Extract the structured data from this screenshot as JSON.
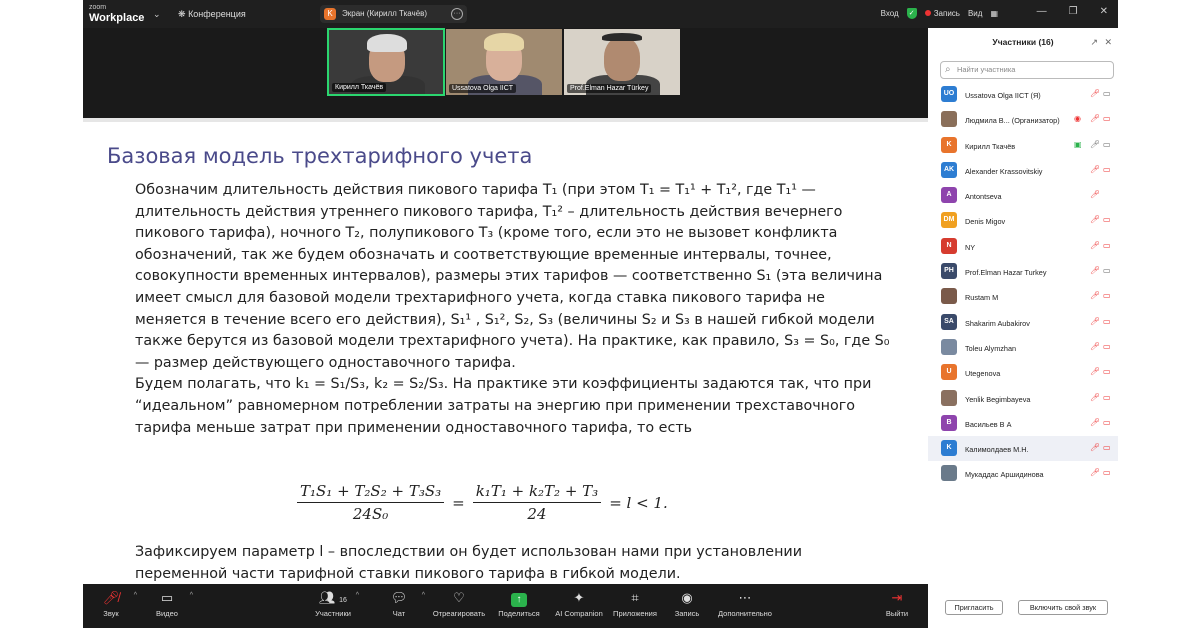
{
  "titlebar": {
    "brand_small": "zoom",
    "brand": "Workplace",
    "conference": "Конференция",
    "share_initial": "K",
    "share_title": "Экран (Кирилл Ткачёв)",
    "view_in": "Вход",
    "record": "Запись",
    "view": "Вид",
    "colors": {
      "bg": "#1f1f1f",
      "record": "#e33333",
      "secure": "#2bb24c"
    }
  },
  "videos": [
    {
      "name": "Кирилл Ткачёв",
      "active": true
    },
    {
      "name": "Ussatova Olga IICT"
    },
    {
      "name": "Prof.Elman Hazar Türkey"
    }
  ],
  "slide": {
    "title": "Базовая модель трехтарифного учета",
    "p1": "Обозначим длительность действия пикового тарифа T₁ (при этом T₁ = T₁¹ + T₁², где T₁¹ — длительность действия утреннего пикового тарифа, T₁² – длительность действия вечернего пикового тарифа), ночного T₂, полупикового T₃ (кроме того, если это не вызовет конфликта обозначений, так же будем обозначать и соответствующие временные интервалы, точнее, совокупности временных интервалов), размеры этих тарифов — соответственно S₁ (эта величина имеет смысл для базовой модели трехтарифного учета, когда ставка пикового тарифа не меняется в течение всего его действия), S₁¹ , S₁², S₂, S₃ (величины S₂ и S₃ в нашей гибкой модели также берутся из базовой модели трехтарифного учета). На практике, как правило, S₃ = S₀, где S₀ — размер действующего одноставочного тарифа.",
    "p2": "Будем полагать, что k₁ = S₁/S₃, k₂ = S₂/S₃. На практике эти коэффициенты задаются так, что при “идеальном” равномерном потреблении затраты на энергию при применении трехставочного тарифа меньше затрат при применении одноставочного тарифа, то есть",
    "f_num1": "T₁S₁ + T₂S₂ + T₃S₃",
    "f_den1": "24S₀",
    "f_eq1": "=",
    "f_num2": "k₁T₁ + k₂T₂ + T₃",
    "f_den2": "24",
    "f_tail": "= l < 1.",
    "p3": "Зафиксируем параметр l – впоследствии он будет использован нами при установлении переменной части тарифной ставки пикового тарифа в гибкой модели."
  },
  "toolbar": {
    "audio": "Звук",
    "video": "Видео",
    "participants": "Участники",
    "participants_count": "16",
    "chat": "Чат",
    "react": "Отреагировать",
    "share": "Поделиться",
    "ai": "AI Companion",
    "apps": "Приложения",
    "record": "Запись",
    "more": "Дополнительно",
    "leave": "Выйти"
  },
  "panel": {
    "title": "Участники (16)",
    "search_placeholder": "Найти участника",
    "invite": "Пригласить",
    "unmute": "Включить свой звук",
    "participants": [
      {
        "initials": "UO",
        "color": "#2d7dd2",
        "name": "Ussatova Olga IICT (Я)",
        "mic": "off",
        "cam": "on"
      },
      {
        "initials": "",
        "color": "#8a6f5a",
        "name": "Людмила В...  (Организатор)",
        "mic": "off",
        "cam": "off",
        "rec": true
      },
      {
        "initials": "K",
        "color": "#e8742c",
        "name": "Кирилл Ткачёв",
        "mic": "on",
        "cam": "on",
        "share": true
      },
      {
        "initials": "AK",
        "color": "#2d7dd2",
        "name": "Alexander Krassovitskiy",
        "mic": "off",
        "cam": "off"
      },
      {
        "initials": "A",
        "color": "#8e44ad",
        "name": "Antontseva",
        "mic": "off",
        "cam": "none"
      },
      {
        "initials": "DM",
        "color": "#f0a020",
        "name": "Denis Migov",
        "mic": "off",
        "cam": "off"
      },
      {
        "initials": "N",
        "color": "#d63c2f",
        "name": "NY",
        "mic": "off",
        "cam": "off"
      },
      {
        "initials": "PH",
        "color": "#3a4a6a",
        "name": "Prof.Elman Hazar Turkey",
        "mic": "off",
        "cam": "on"
      },
      {
        "initials": "",
        "color": "#7a5a4a",
        "name": "Rustam M",
        "mic": "off",
        "cam": "off"
      },
      {
        "initials": "SA",
        "color": "#3a4a6a",
        "name": "Shakarim Aubakirov",
        "mic": "off",
        "cam": "off"
      },
      {
        "initials": "",
        "color": "#7a8aa0",
        "name": "Toleu Alymzhan",
        "mic": "off",
        "cam": "off"
      },
      {
        "initials": "U",
        "color": "#e8742c",
        "name": "Utegenova",
        "mic": "off",
        "cam": "off"
      },
      {
        "initials": "",
        "color": "#8a7060",
        "name": "Yenlik Begimbayeva",
        "mic": "off",
        "cam": "off"
      },
      {
        "initials": "B",
        "color": "#8e44ad",
        "name": "Васильев В А",
        "mic": "off",
        "cam": "off"
      },
      {
        "initials": "K",
        "color": "#2d7dd2",
        "name": "Калимолдаев М.Н.",
        "mic": "off",
        "cam": "off",
        "highlight": true
      },
      {
        "initials": "",
        "color": "#6a7a8a",
        "name": "Мукаддас Аршидинова",
        "mic": "off",
        "cam": "off"
      }
    ]
  }
}
